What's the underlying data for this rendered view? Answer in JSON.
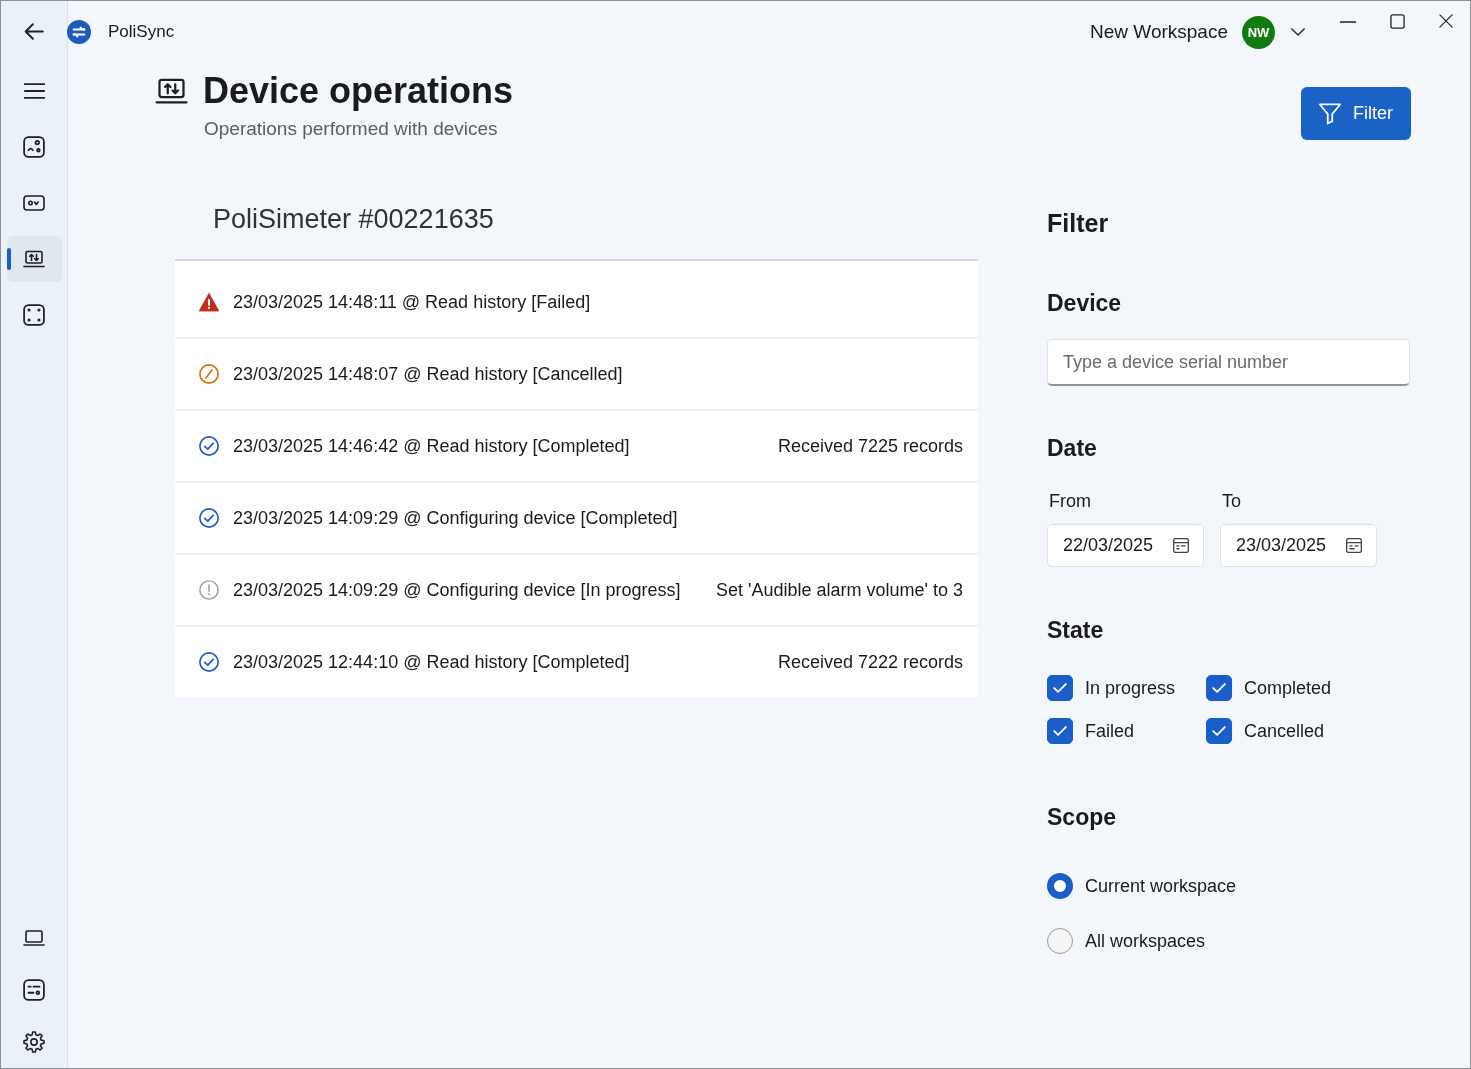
{
  "title_bar": {
    "app_name": "PoliSync",
    "workspace_name": "New Workspace",
    "avatar_initials": "NW"
  },
  "sidebar": {
    "items": [
      {
        "selected": false
      },
      {
        "selected": false
      },
      {
        "selected": true
      },
      {
        "selected": false
      }
    ],
    "footer_items": [
      {
        "selected": false
      },
      {
        "selected": false
      },
      {
        "selected": false
      }
    ]
  },
  "header": {
    "title": "Device operations",
    "subtitle": "Operations performed with devices",
    "filter_button": "Filter"
  },
  "device": {
    "title": "PoliSimeter #00221635",
    "operations": [
      {
        "kind": "failed",
        "text": "23/03/2025 14:48:11 @ Read history [Failed]"
      },
      {
        "kind": "cancelled",
        "text": "23/03/2025 14:48:07 @ Read history [Cancelled]"
      },
      {
        "kind": "completed",
        "text": "23/03/2025 14:46:42 @ Read history [Completed]",
        "detail": "Received 7225 records"
      },
      {
        "kind": "completed",
        "text": "23/03/2025 14:09:29 @ Configuring device [Completed]"
      },
      {
        "kind": "in_progress",
        "text": "23/03/2025 14:09:29 @ Configuring device [In progress]",
        "detail": "Set 'Audible alarm volume' to 3"
      },
      {
        "kind": "completed",
        "text": "23/03/2025 12:44:10 @ Read history [Completed]",
        "detail": "Received 7222 records"
      }
    ]
  },
  "filter_panel": {
    "title": "Filter",
    "device": {
      "label": "Device",
      "placeholder": "Type a device serial number"
    },
    "date": {
      "label": "Date",
      "from": {
        "label": "From",
        "value": "22/03/2025"
      },
      "to": {
        "label": "To",
        "value": "23/03/2025"
      }
    },
    "state": {
      "label": "State",
      "options": [
        {
          "label": "In progress",
          "checked": true
        },
        {
          "label": "Completed",
          "checked": true
        },
        {
          "label": "Failed",
          "checked": true
        },
        {
          "label": "Cancelled",
          "checked": true
        }
      ]
    },
    "scope": {
      "label": "Scope",
      "options": [
        {
          "label": "Current workspace",
          "selected": true
        },
        {
          "label": "All workspaces",
          "selected": false
        }
      ]
    }
  }
}
